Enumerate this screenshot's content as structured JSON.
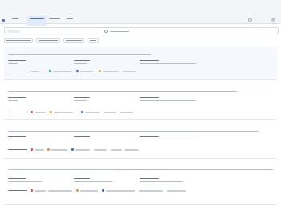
{
  "nav": {
    "tabs": [
      {
        "active": false
      },
      {
        "active": true
      },
      {
        "active": false
      },
      {
        "active": false
      }
    ]
  },
  "toolbar": {
    "buttons": [
      {},
      {},
      {},
      {}
    ]
  },
  "cards": [
    {
      "title": "",
      "highlight": true,
      "meta_fields": 3
    },
    {
      "title": "",
      "highlight": false,
      "meta_fields": 3
    },
    {
      "title": "",
      "highlight": false,
      "meta_fields": 3
    },
    {
      "title": "",
      "highlight": false,
      "meta_fields": 3
    }
  ],
  "colors": {
    "accent": "#3b6fd8",
    "title_text": "#2c3e63",
    "badge_red": "#d9534f",
    "badge_orange": "#e89a3c",
    "badge_green": "#3aa76d",
    "badge_blue": "#3b6fd8"
  }
}
